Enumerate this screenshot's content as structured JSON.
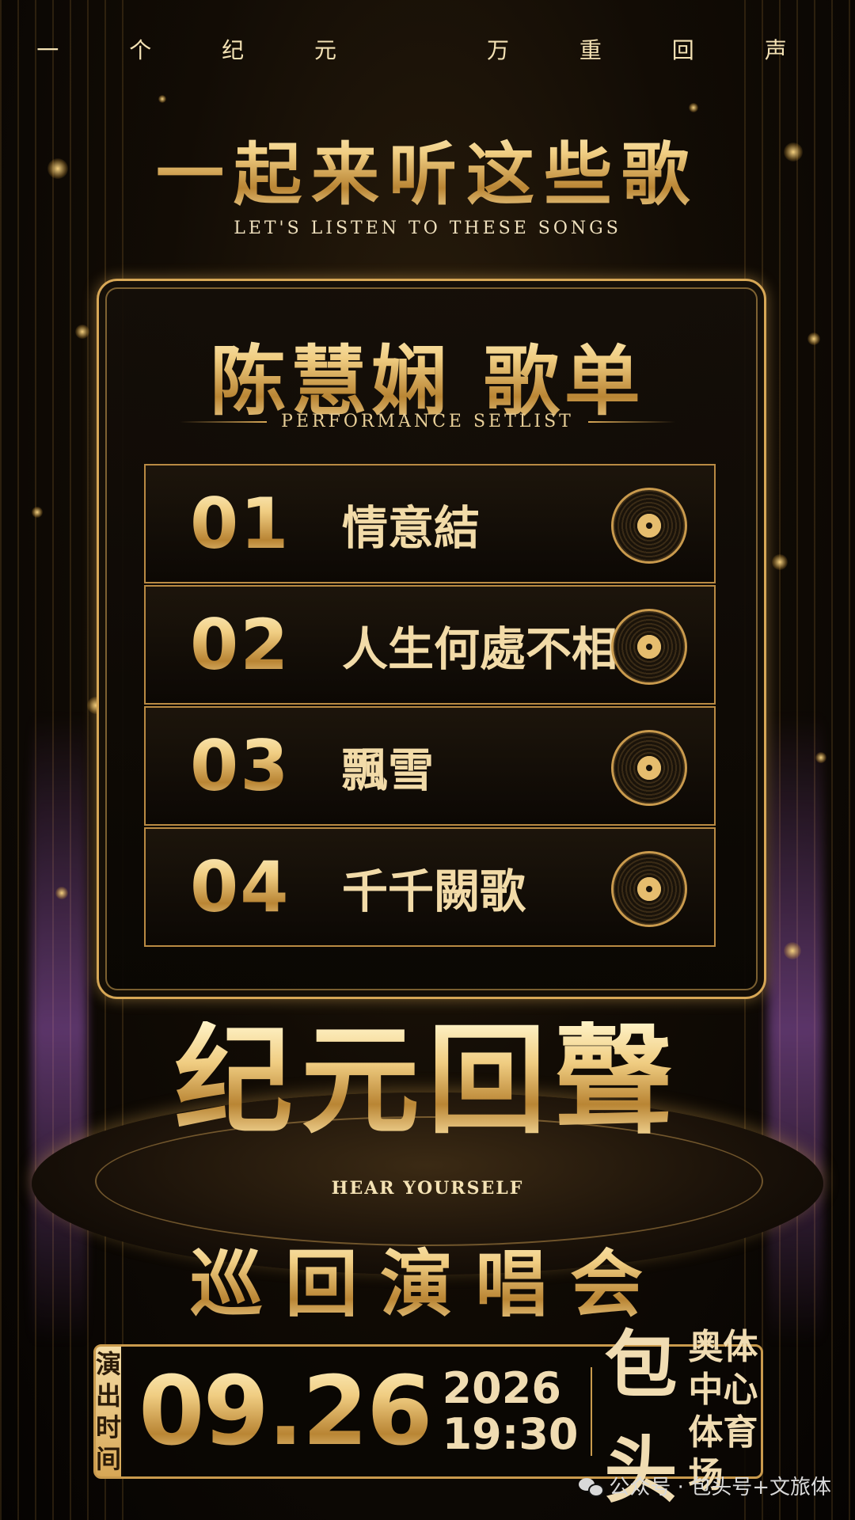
{
  "tagline": [
    "一 个 纪 元",
    "万 重 回 声"
  ],
  "headline": "一起来听这些歌",
  "headline_en": "LET'S LISTEN TO THESE SONGS",
  "setlist_title": "陈慧娴 歌单",
  "setlist_subtitle": "PERFORMANCE SETLIST",
  "songs": [
    {
      "num": "01",
      "title": "情意結",
      "icon": "vinyl-record-icon"
    },
    {
      "num": "02",
      "title": "人生何處不相逢",
      "icon": "vinyl-record-icon"
    },
    {
      "num": "03",
      "title": "飄雪",
      "icon": "vinyl-record-icon"
    },
    {
      "num": "04",
      "title": "千千闕歌",
      "icon": "vinyl-record-icon"
    }
  ],
  "logo": "纪元回聲",
  "logo_en": "HEAR YOURSELF",
  "tour_name": "巡回演唱会",
  "info": {
    "tag": [
      "演",
      "出",
      "时",
      "间"
    ],
    "date": "09.26",
    "year": "2026",
    "time": "19:30",
    "city": "包头",
    "venue_line1": "奥体中心",
    "venue_line2": "体育场"
  },
  "watermark": "公众号 · 包头号+文旅体",
  "colors": {
    "gold": "#d7a756",
    "background": "#0b0704"
  }
}
